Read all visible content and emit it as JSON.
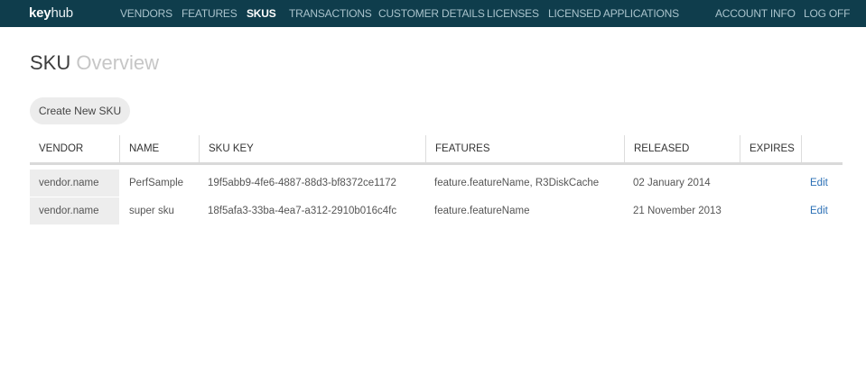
{
  "brand": {
    "part1": "key",
    "part2": "hub"
  },
  "nav": {
    "items": [
      "VENDORS",
      "FEATURES",
      "SKUS",
      "TRANSACTIONS",
      "CUSTOMER DETAILS",
      "LICENSES",
      "LICENSED APPLICATIONS"
    ],
    "active": "SKUS",
    "account": [
      "ACCOUNT INFO",
      "LOG OFF"
    ]
  },
  "page": {
    "title": "SKU",
    "title_light": "Overview"
  },
  "actions": {
    "create_label": "Create New SKU"
  },
  "table": {
    "columns": [
      "VENDOR",
      "NAME",
      "SKU KEY",
      "FEATURES",
      "RELEASED",
      "EXPIRES"
    ],
    "rows": [
      {
        "vendor": "vendor.name",
        "name": "PerfSample",
        "sku_key": "19f5abb9-4fe6-4887-88d3-bf8372ce1172",
        "features": "feature.featureName, R3DiskCache",
        "released": "02 January 2014",
        "expires": "",
        "edit": "Edit"
      },
      {
        "vendor": "vendor.name",
        "name": "super sku",
        "sku_key": "18f5afa3-33ba-4ea7-a312-2910b016c4fc",
        "features": "feature.featureName",
        "released": "21 November 2013",
        "expires": "",
        "edit": "Edit"
      }
    ]
  },
  "colors": {
    "topbar": "#0f3d4c",
    "link": "#2a6fb5",
    "nav_text": "#a9c3cc"
  }
}
